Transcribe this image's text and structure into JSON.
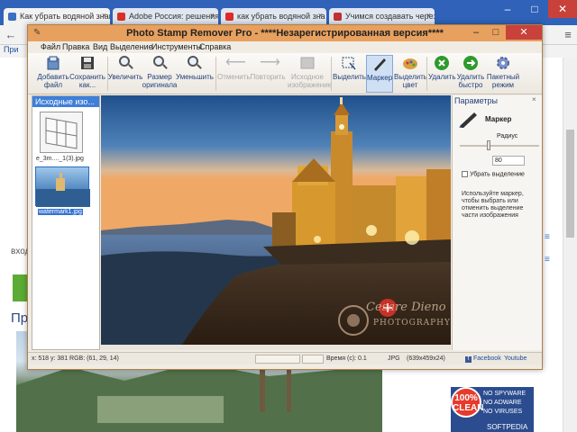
{
  "browser": {
    "tabs": [
      {
        "label": "Как убрать водяной знак",
        "fav_color": "#3a6fc1"
      },
      {
        "label": "Adobe Россия: решения",
        "fav_color": "#d93025"
      },
      {
        "label": "как убрать водяной зна",
        "fav_color": "#e02a2a"
      },
      {
        "label": "Учимся создавать через",
        "fav_color": "#c23030"
      }
    ],
    "bookmark_label": "При",
    "page_text_1": "вход",
    "page_heading": "Пр",
    "badge": {
      "percent": "100%",
      "clean": "CLEAN",
      "lines": [
        "NO SPYWARE",
        "NO ADWARE",
        "NO VIRUSES"
      ],
      "soft": "SOFTPEDIA"
    }
  },
  "app": {
    "title": "Photo Stamp Remover Pro - ****Незарегистрированная версия****",
    "menu": [
      "Файл",
      "Правка",
      "Вид",
      "Выделение",
      "Инструменты",
      "Справка"
    ],
    "toolbar": {
      "add_file": "Добавить файл",
      "save_as": "Сохранить как...",
      "zoom_in": "Увеличить",
      "original_size": "Размер оригинала",
      "zoom_out": "Уменьшить",
      "undo": "Отменить",
      "redo": "Повторить",
      "source_image": "Исходное изображение",
      "select": "Выделить",
      "marker": "Маркер",
      "select_color": "Выделить цвет",
      "remove": "Удалить",
      "remove_fast": "Удалить быстро",
      "batch": "Пакетный режим"
    },
    "left_panel": {
      "header": "Исходные изо...",
      "files": [
        "e_3m...._1(3).jpg",
        "watermark1.jpg"
      ]
    },
    "right_panel": {
      "title": "Параметры",
      "tool_name": "Маркер",
      "radius_label": "Радиус",
      "radius_value": "80",
      "clear_selection": "Убрать выделение",
      "help": "Используйте маркер, чтобы выбрать или отменить выделение части изображения"
    },
    "status": {
      "coords": "x: 518 y: 381 RGB: (61, 29, 14)",
      "time": "Время (с): 0.1",
      "format": "JPG",
      "dims": "(639x459x24)",
      "facebook": "Facebook",
      "youtube": "Youtube"
    },
    "watermark": {
      "line1": "Cesare Dieno",
      "line2": "PHOTOGRAPHY"
    }
  }
}
